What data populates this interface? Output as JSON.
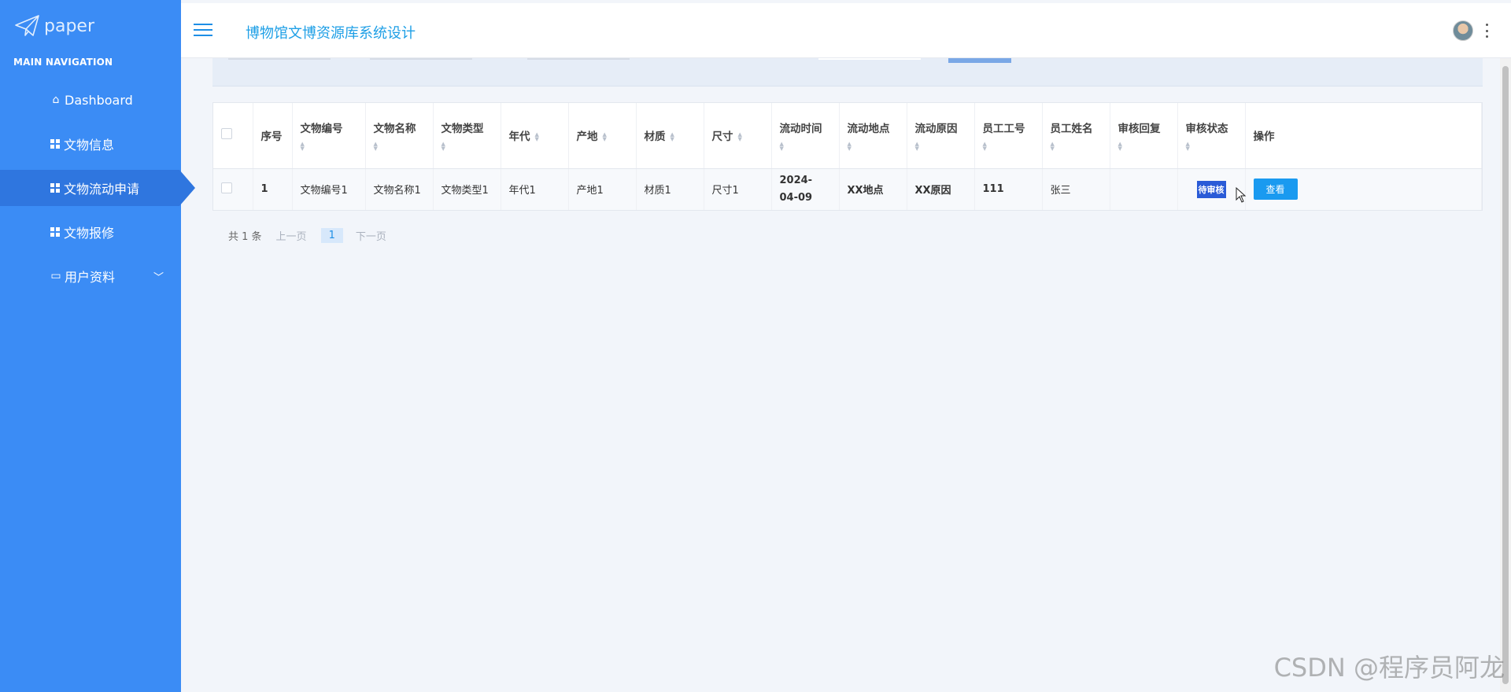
{
  "brand": {
    "name": "paper"
  },
  "sidebar": {
    "section_title": "MAIN NAVIGATION",
    "items": [
      {
        "label": "Dashboard",
        "icon": "home-icon"
      },
      {
        "label": "文物信息",
        "icon": "grid-icon"
      },
      {
        "label": "文物流动申请",
        "icon": "grid-icon",
        "active": true
      },
      {
        "label": "文物报修",
        "icon": "grid-icon"
      },
      {
        "label": "用户资料",
        "icon": "card-icon"
      }
    ]
  },
  "header": {
    "title": "博物馆文博资源库系统设计"
  },
  "table": {
    "columns": [
      "序号",
      "文物编号",
      "文物名称",
      "文物类型",
      "年代",
      "产地",
      "材质",
      "尺寸",
      "流动时间",
      "流动地点",
      "流动原因",
      "员工工号",
      "员工姓名",
      "审核回复",
      "审核状态",
      "操作"
    ],
    "rows": [
      {
        "index": "1",
        "code": "文物编号1",
        "name": "文物名称1",
        "type": "文物类型1",
        "era": "年代1",
        "origin": "产地1",
        "material": "材质1",
        "size": "尺寸1",
        "flow_time": "2024-04-09",
        "flow_place": "XX地点",
        "flow_reason": "XX原因",
        "staff_no": "111",
        "staff_name": "张三",
        "review_reply": "",
        "review_status": "待审核",
        "action": "查看"
      }
    ]
  },
  "pager": {
    "total": "共 1 条",
    "prev": "上一页",
    "current": "1",
    "next": "下一页"
  },
  "watermark": "CSDN @程序员阿龙",
  "colors": {
    "sidebar": "#3b8cf5",
    "sidebar_active": "#2f76df",
    "accent": "#1e9fe6",
    "view_button": "#1a9af0",
    "status_tag": "#2a5bd7"
  }
}
